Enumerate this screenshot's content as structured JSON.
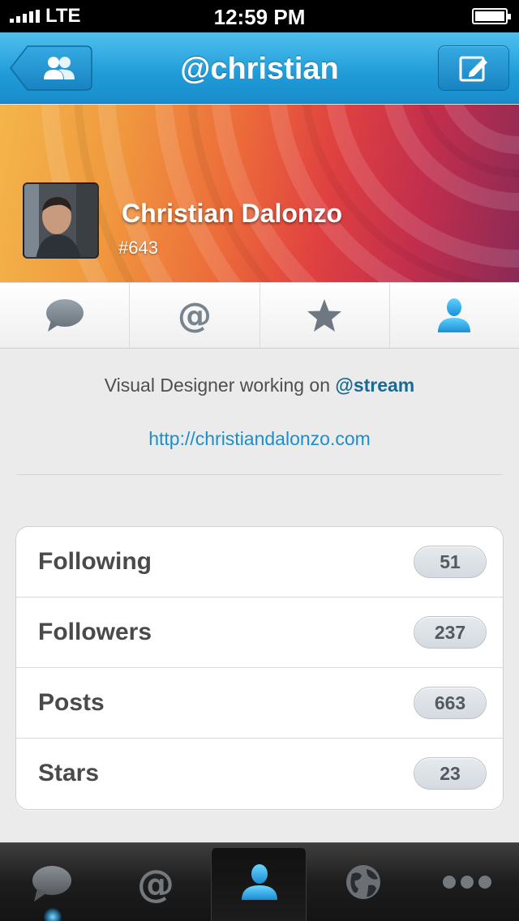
{
  "status_bar": {
    "carrier": "LTE",
    "time": "12:59 PM"
  },
  "nav": {
    "title": "@christian",
    "back_icon": "users-icon",
    "compose_icon": "compose-icon"
  },
  "profile": {
    "name": "Christian Dalonzo",
    "id": "#643"
  },
  "segments": [
    {
      "icon": "speech-bubble-icon",
      "active": false
    },
    {
      "icon": "at-sign-icon",
      "active": false
    },
    {
      "icon": "star-icon",
      "active": false
    },
    {
      "icon": "person-icon",
      "active": true
    }
  ],
  "bio": {
    "text": "Visual Designer working on ",
    "handle": "@stream",
    "link": "http://christiandalonzo.com"
  },
  "stats": [
    {
      "label": "Following",
      "count": "51"
    },
    {
      "label": "Followers",
      "count": "237"
    },
    {
      "label": "Posts",
      "count": "663"
    },
    {
      "label": "Stars",
      "count": "23"
    }
  ],
  "tab_bar": [
    {
      "icon": "speech-bubble-icon",
      "active": false
    },
    {
      "icon": "at-sign-icon",
      "active": false
    },
    {
      "icon": "person-icon",
      "active": true
    },
    {
      "icon": "globe-icon",
      "active": false
    },
    {
      "icon": "more-dots-icon",
      "active": false
    }
  ],
  "colors": {
    "nav_blue": "#1f9bd8",
    "accent_blue": "#1b8fcb",
    "handle_blue": "#1a6a96"
  }
}
